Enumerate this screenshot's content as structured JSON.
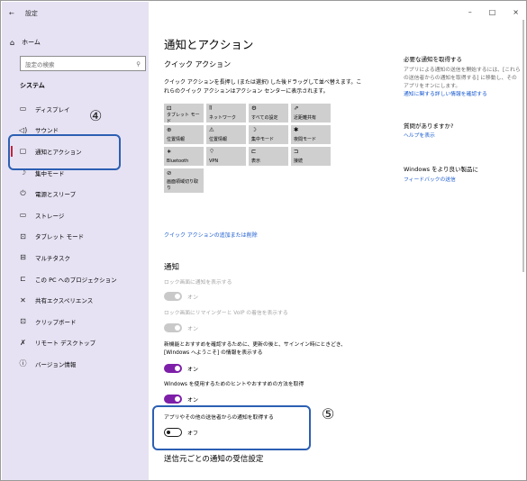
{
  "window": {
    "back": "←",
    "title": "設定",
    "controls": {
      "minimize": "–",
      "maximize": "□",
      "close": "×"
    }
  },
  "sidebar": {
    "home": "ホーム",
    "search_placeholder": "設定の検索",
    "section": "システム",
    "items": [
      {
        "icon": "display-icon",
        "glyph": "▭",
        "label": "ディスプレイ"
      },
      {
        "icon": "sound-icon",
        "glyph": "◁)",
        "label": "サウンド"
      },
      {
        "icon": "notification-icon",
        "glyph": "▢",
        "label": "通知とアクション",
        "active": true
      },
      {
        "icon": "focus-assist-icon",
        "glyph": "☽",
        "label": "集中モード"
      },
      {
        "icon": "power-icon",
        "glyph": "⏻",
        "label": "電源とスリープ"
      },
      {
        "icon": "storage-icon",
        "glyph": "▭",
        "label": "ストレージ"
      },
      {
        "icon": "tablet-icon",
        "glyph": "⊡",
        "label": "タブレット モード"
      },
      {
        "icon": "multitask-icon",
        "glyph": "⊟",
        "label": "マルチタスク"
      },
      {
        "icon": "projecting-icon",
        "glyph": "⊏",
        "label": "この PC へのプロジェクション"
      },
      {
        "icon": "shared-icon",
        "glyph": "✕",
        "label": "共有エクスペリエンス"
      },
      {
        "icon": "clipboard-icon",
        "glyph": "⊡",
        "label": "クリップボード"
      },
      {
        "icon": "remote-icon",
        "glyph": "✗",
        "label": "リモート デスクトップ"
      },
      {
        "icon": "info-icon",
        "glyph": "ⓘ",
        "label": "バージョン情報"
      }
    ]
  },
  "main": {
    "title": "通知とアクション",
    "quick_actions_title": "クイック アクション",
    "quick_actions_desc": "クイック アクションを長押し (または選択) した後ドラッグして並べ替えます。これらのクイック アクションはアクション センターに表示されます。",
    "tiles": [
      {
        "glyph": "⊡",
        "label": "タブレット モード"
      },
      {
        "glyph": "⫪",
        "label": "ネットワーク"
      },
      {
        "glyph": "⚙",
        "label": "すべての設定"
      },
      {
        "glyph": "⇗",
        "label": "近距離共有"
      },
      {
        "glyph": "⊕",
        "label": "位置情報"
      },
      {
        "glyph": "⚠",
        "label": "位置情報"
      },
      {
        "glyph": "☽",
        "label": "集中モード"
      },
      {
        "glyph": "✱",
        "label": "夜間モード"
      },
      {
        "glyph": "∗",
        "label": "Bluetooth"
      },
      {
        "glyph": "⌔",
        "label": "VPN"
      },
      {
        "glyph": "⊏",
        "label": "表示"
      },
      {
        "glyph": "⊐",
        "label": "接続"
      },
      {
        "glyph": "⊘",
        "label": "画面領域切り取り"
      }
    ],
    "edit_link": "クイック アクションの追加または削除",
    "notifications_title": "通知",
    "options": [
      {
        "text": "ロック画面に通知を表示する",
        "state": "オン",
        "dim": true
      },
      {
        "text": "ロック画面にリマインダーと VoIP の着信を表示する",
        "state": "オン",
        "dim": true
      },
      {
        "text": "新機能とおすすめを確認するために、更新の後と、サインイン時にときどき、[Windows へようこそ] の情報を表示する",
        "state": "オン",
        "dim": false
      },
      {
        "text": "Windows を使用するためのヒントやおすすめの方法を取得",
        "state": "オン",
        "dim": false
      },
      {
        "text": "アプリやその他の送信者からの通知を取得する",
        "state": "オフ",
        "dim": false
      }
    ],
    "per_sender_title": "送信元ごとの通知の受信設定"
  },
  "right": {
    "section1_title": "必要な通知を取得する",
    "section1_desc": "アプリによる通知の送信を開始するには、[これらの送信者からの通知を取得する] に移動し、そのアプリをオンにします。",
    "section1_link": "通知に関する詳しい情報を確認する",
    "section2_title": "質問がありますか?",
    "section2_link": "ヘルプを表示",
    "section3_title": "Windows をより良い製品に",
    "section3_link": "フィードバックの送信"
  },
  "annotations": {
    "marker4": "④",
    "marker5": "⑤"
  },
  "colors": {
    "accent": "#7d1fa8",
    "link": "#1a5bd0",
    "sidebar": "#e6e2f3",
    "annotation": "#2c5fb3"
  }
}
